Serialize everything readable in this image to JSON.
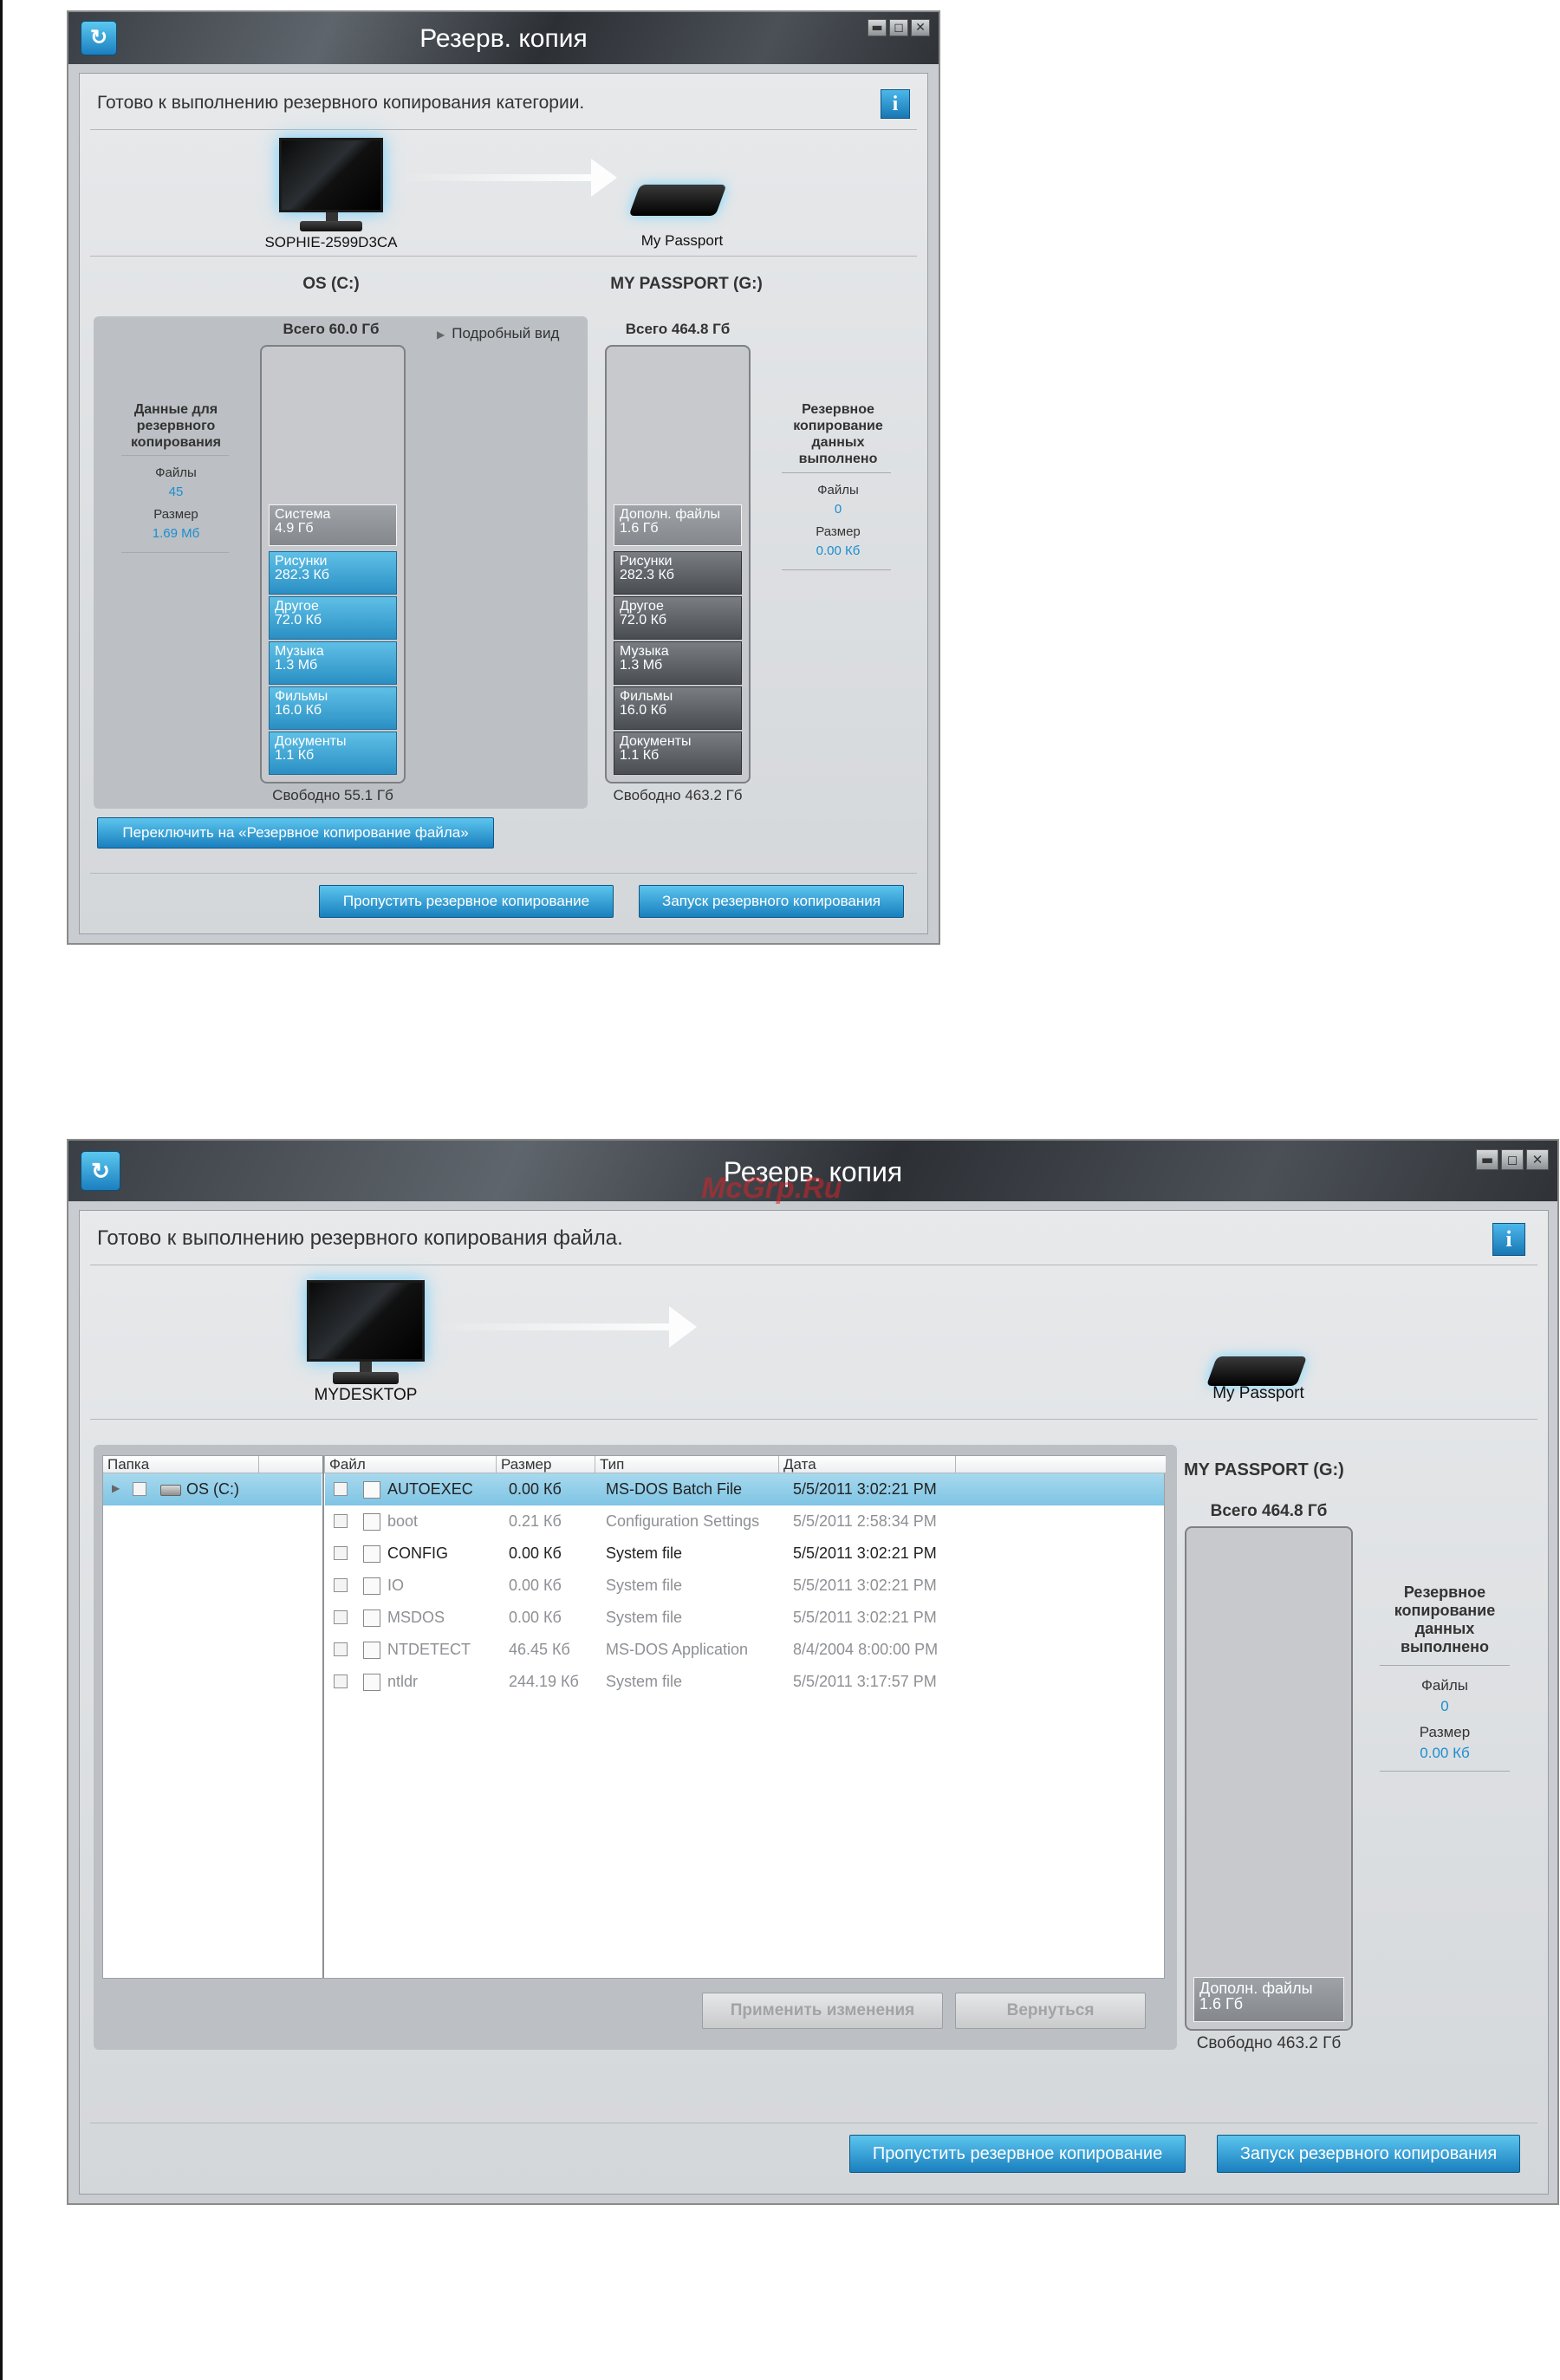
{
  "top_window": {
    "title": "Резерв. копия",
    "status": "Готово к выполнению резервного копирования категории.",
    "info_label": "i",
    "computer_name": "SOPHIE-2599D3CA",
    "drive_name": "My Passport",
    "left_drive_header": "OS (C:)",
    "right_drive_header": "MY PASSPORT (G:)",
    "left_total": "Всего 60.0 Гб",
    "right_total": "Всего 464.8 Гб",
    "detail_view": "Подробный вид",
    "left_side": {
      "heading": "Данные для резервного копирования",
      "files_label": "Файлы",
      "files_value": "45",
      "size_label": "Размер",
      "size_value": "1.69 Мб"
    },
    "right_side": {
      "heading": "Резервное копирование данных выполнено",
      "files_label": "Файлы",
      "files_value": "0",
      "size_label": "Размер",
      "size_value": "0.00 Кб"
    },
    "left_segments": [
      {
        "name": "Система",
        "value": "4.9 Гб"
      },
      {
        "name": "Рисунки",
        "value": "282.3 Кб"
      },
      {
        "name": "Другое",
        "value": "72.0 Кб"
      },
      {
        "name": "Музыка",
        "value": "1.3 Мб"
      },
      {
        "name": "Фильмы",
        "value": "16.0 Кб"
      },
      {
        "name": "Документы",
        "value": "1.1 Кб"
      }
    ],
    "right_segments": [
      {
        "name": "Дополн. файлы",
        "value": "1.6 Гб"
      },
      {
        "name": "Рисунки",
        "value": "282.3 Кб"
      },
      {
        "name": "Другое",
        "value": "72.0 Кб"
      },
      {
        "name": "Музыка",
        "value": "1.3 Мб"
      },
      {
        "name": "Фильмы",
        "value": "16.0 Кб"
      },
      {
        "name": "Документы",
        "value": "1.1 Кб"
      }
    ],
    "left_free": "Свободно 55.1 Гб",
    "right_free": "Свободно 463.2 Гб",
    "switch_button": "Переключить на «Резервное копирование файла»",
    "skip_button": "Пропустить резервное копирование",
    "start_button": "Запуск резервного копирования"
  },
  "bottom_window": {
    "title": "Резерв. копия",
    "watermark": "McGrp.Ru",
    "status": "Готово к выполнению резервного копирования файла.",
    "info_label": "i",
    "computer_name": "MYDESKTOP",
    "drive_name": "My Passport",
    "drive_header": "MY PASSPORT (G:)",
    "drive_total": "Всего 464.8 Гб",
    "drive_segment": {
      "name": "Дополн. файлы",
      "value": "1.6 Гб"
    },
    "drive_free": "Свободно 463.2 Гб",
    "right_side": {
      "heading": "Резервное копирование данных выполнено",
      "files_label": "Файлы",
      "files_value": "0",
      "size_label": "Размер",
      "size_value": "0.00 Кб"
    },
    "columns": {
      "folder": "Папка",
      "file": "Файл",
      "size": "Размер",
      "type": "Тип",
      "date": "Дата"
    },
    "folder_item": "OS (C:)",
    "files": [
      {
        "name": "AUTOEXEC",
        "size": "0.00 Кб",
        "type": "MS-DOS Batch File",
        "date": "5/5/2011 3:02:21 PM",
        "selected": true
      },
      {
        "name": "boot",
        "size": "0.21 Кб",
        "type": "Configuration Settings",
        "date": "5/5/2011 2:58:34 PM",
        "selected": false
      },
      {
        "name": "CONFIG",
        "size": "0.00 Кб",
        "type": "System file",
        "date": "5/5/2011 3:02:21 PM",
        "selected": false
      },
      {
        "name": "IO",
        "size": "0.00 Кб",
        "type": "System file",
        "date": "5/5/2011 3:02:21 PM",
        "selected": false
      },
      {
        "name": "MSDOS",
        "size": "0.00 Кб",
        "type": "System file",
        "date": "5/5/2011 3:02:21 PM",
        "selected": false
      },
      {
        "name": "NTDETECT",
        "size": "46.45 Кб",
        "type": "MS-DOS Application",
        "date": "8/4/2004 8:00:00 PM",
        "selected": false
      },
      {
        "name": "ntldr",
        "size": "244.19 Кб",
        "type": "System file",
        "date": "5/5/2011 3:17:57 PM",
        "selected": false
      }
    ],
    "apply_button": "Применить изменения",
    "revert_button": "Вернуться",
    "skip_button": "Пропустить резервное копирование",
    "start_button": "Запуск резервного копирования"
  }
}
